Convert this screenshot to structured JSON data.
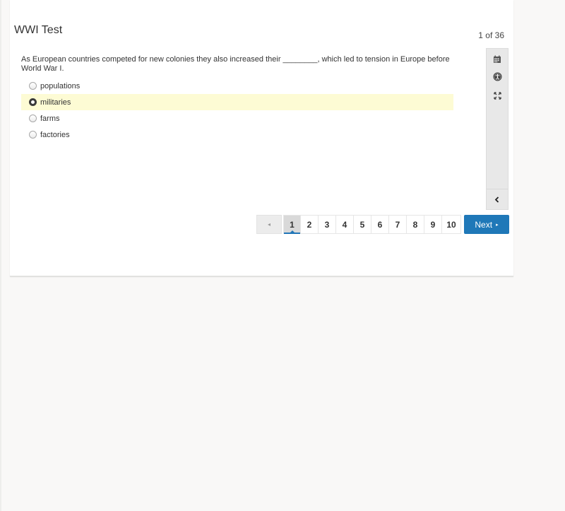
{
  "header": {
    "title": "WWI Test",
    "counter": "1 of 36"
  },
  "question": {
    "text": "As European countries competed for new colonies they also increased their ________, which led to tension in Europe before World War I.",
    "choices": [
      {
        "label": "populations",
        "selected": false
      },
      {
        "label": "militaries",
        "selected": true
      },
      {
        "label": "farms",
        "selected": false
      },
      {
        "label": "factories",
        "selected": false
      }
    ]
  },
  "toolbar": {
    "tools": [
      {
        "icon": "calendar-icon",
        "label": "Calculator"
      },
      {
        "icon": "accessibility-icon",
        "label": "Accessibility"
      },
      {
        "icon": "expand-icon",
        "label": "Expand"
      },
      {
        "icon": "chevron-left-icon",
        "label": "Collapse"
      }
    ]
  },
  "pagination": {
    "prev_icon": "◂",
    "pages": [
      "1",
      "2",
      "3",
      "4",
      "5",
      "6",
      "7",
      "8",
      "9",
      "10"
    ],
    "active_page": "1",
    "next_label": "Next",
    "next_icon": "▸"
  },
  "colors": {
    "accent": "#1f78b8",
    "selected_row": "#fdfbd4",
    "background": "#f9f8f7"
  }
}
